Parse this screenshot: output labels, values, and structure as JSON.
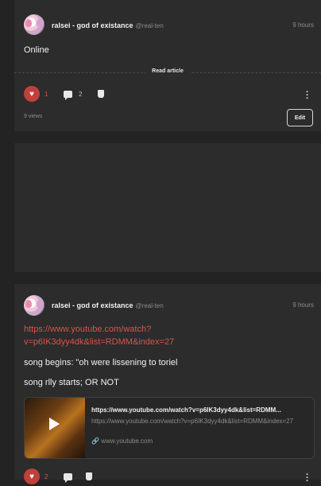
{
  "posts": [
    {
      "author": "ralsei - god of existance",
      "handle": "@real-ten",
      "time": "9 hours",
      "body": "Online",
      "read_article": "Read article",
      "likes": "1",
      "comments": "2",
      "views": "9 views",
      "edit_label": "Edit"
    },
    {
      "author": "ralsei - god of existance",
      "handle": "@real-ten",
      "time": "9 hours",
      "link": "https://www.youtube.com/watch?v=p6IK3dyy4dk&list=RDMM&index=27",
      "line1": "song begins: \"oh were lissening to toriel",
      "line2": "song rlly starts; OR NOT",
      "embed": {
        "title": "https://www.youtube.com/watch?v=p6IK3dyy4dk&list=RDMM...",
        "description": "https://www.youtube.com/watch?v=p6IK3dyy4dk&list=RDMM&index=27",
        "domain": "www.youtube.com"
      },
      "likes": "2"
    }
  ],
  "colors": {
    "accent": "#c0403a",
    "link": "#d9534f",
    "card": "#2b2c2b",
    "background": "#222322"
  },
  "icons": [
    "heart-icon",
    "comment-icon",
    "paint-brush-icon",
    "more-vertical-icon",
    "link-icon",
    "play-icon"
  ]
}
